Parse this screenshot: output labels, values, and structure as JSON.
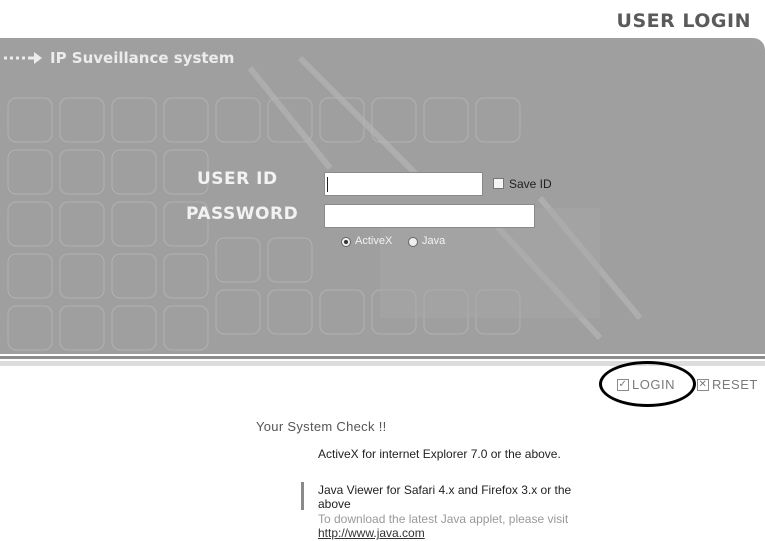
{
  "header": {
    "title": "USER LOGIN"
  },
  "panel": {
    "system_name": "IP Suveillance system"
  },
  "form": {
    "user_id_label": "USER ID",
    "user_id_value": "",
    "password_label": "PASSWORD",
    "password_value": "",
    "save_id_label": "Save ID",
    "save_id_checked": false,
    "viewer_options": [
      "ActiveX",
      "Java"
    ],
    "viewer_selected": "ActiveX"
  },
  "actions": {
    "login_label": "LOGIN",
    "reset_label": "RESET"
  },
  "system_check": {
    "title": "Your System Check !!",
    "activex_text": "ActiveX for internet Explorer 7.0 or the above.",
    "java_text_line1": "Java Viewer for Safari 4.x and Firefox 3.x or the",
    "java_text_line2": "above",
    "download_note": "To download the latest Java applet, please visit",
    "java_link": "http://www.java.com"
  }
}
